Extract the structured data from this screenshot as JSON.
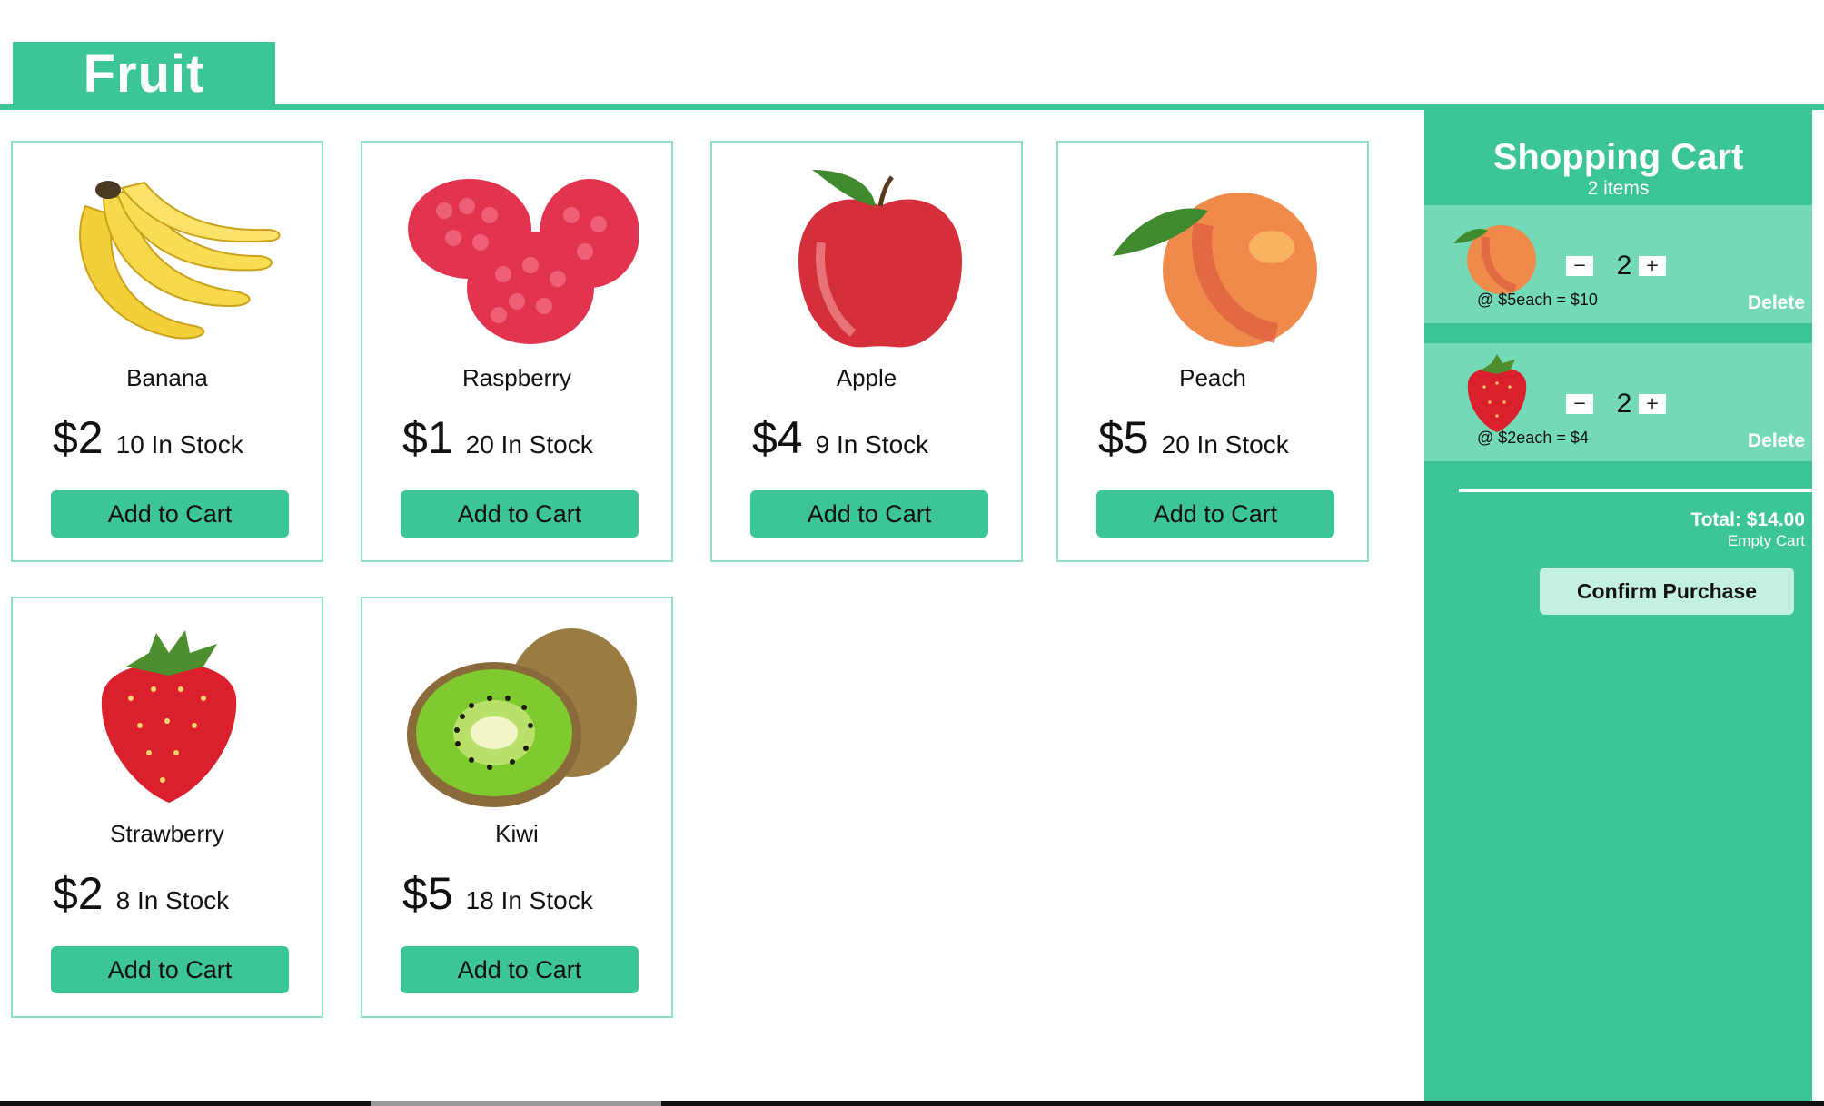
{
  "header": {
    "title": "Fruit"
  },
  "colors": {
    "accent": "#3cc595",
    "cart_item_bg": "#74d9b6",
    "confirm_bg": "#c4f0e0"
  },
  "products": [
    {
      "name": "Banana",
      "price": "$2",
      "stock": "10 In Stock",
      "button": "Add to Cart",
      "icon": "banana-image"
    },
    {
      "name": "Raspberry",
      "price": "$1",
      "stock": "20 In Stock",
      "button": "Add to Cart",
      "icon": "raspberry-image"
    },
    {
      "name": "Apple",
      "price": "$4",
      "stock": "9 In Stock",
      "button": "Add to Cart",
      "icon": "apple-image"
    },
    {
      "name": "Peach",
      "price": "$5",
      "stock": "20 In Stock",
      "button": "Add to Cart",
      "icon": "peach-image"
    },
    {
      "name": "Strawberry",
      "price": "$2",
      "stock": "8 In Stock",
      "button": "Add to Cart",
      "icon": "strawberry-image"
    },
    {
      "name": "Kiwi",
      "price": "$5",
      "stock": "18 In Stock",
      "button": "Add to Cart",
      "icon": "kiwi-image"
    }
  ],
  "cart": {
    "title": "Shopping Cart",
    "count": "2 items",
    "items": [
      {
        "qty": "2",
        "line": "@ $5each = $10",
        "delete": "Delete",
        "minus": "−",
        "plus": "+",
        "icon": "peach-thumbnail"
      },
      {
        "qty": "2",
        "line": "@ $2each = $4",
        "delete": "Delete",
        "minus": "−",
        "plus": "+",
        "icon": "strawberry-thumbnail"
      }
    ],
    "total": "Total: $14.00",
    "empty": "Empty Cart",
    "confirm": "Confirm Purchase"
  }
}
